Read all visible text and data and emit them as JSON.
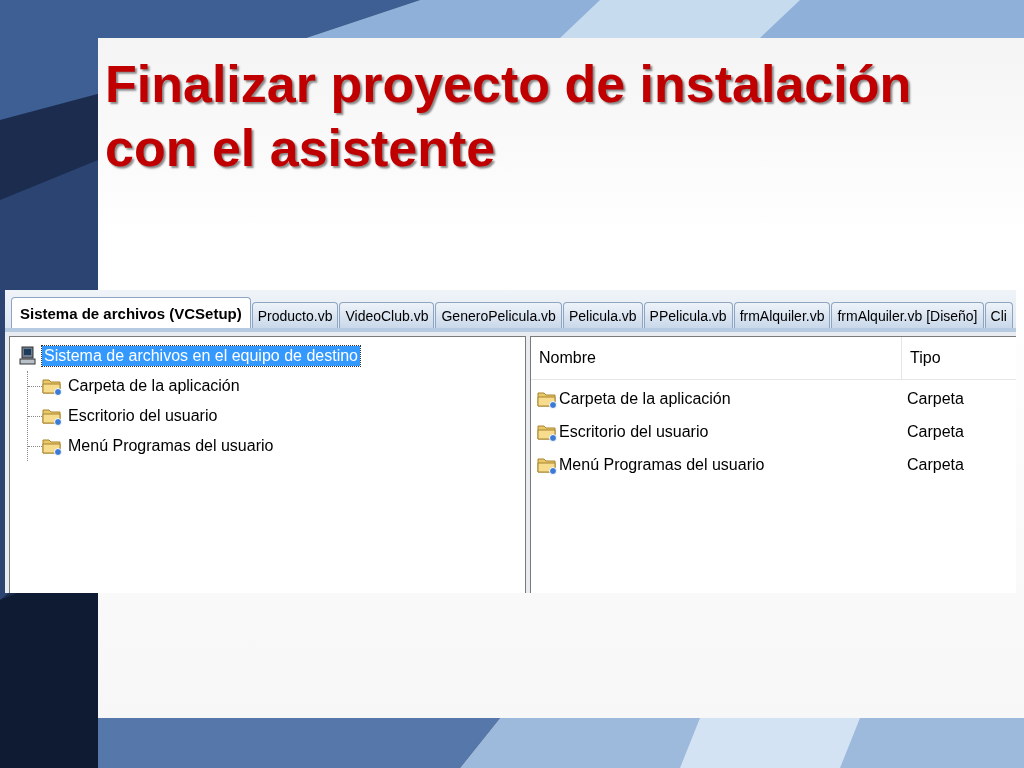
{
  "slide": {
    "title": "Finalizar proyecto de instalación con el asistente"
  },
  "tabs": [
    {
      "label": "Sistema de archivos (VCSetup)",
      "selected": true
    },
    {
      "label": "Producto.vb",
      "selected": false
    },
    {
      "label": "VideoClub.vb",
      "selected": false
    },
    {
      "label": "GeneroPelicula.vb",
      "selected": false
    },
    {
      "label": "Pelicula.vb",
      "selected": false
    },
    {
      "label": "PPelicula.vb",
      "selected": false
    },
    {
      "label": "frmAlquiler.vb",
      "selected": false
    },
    {
      "label": "frmAlquiler.vb [Diseño]",
      "selected": false
    },
    {
      "label": "Cli",
      "selected": false
    }
  ],
  "tree": {
    "items": [
      {
        "label": "Sistema de archivos en el equipo de destino",
        "kind": "computer",
        "selected": true,
        "children": [
          {
            "label": "Carpeta de la aplicación",
            "kind": "folder",
            "selected": false
          },
          {
            "label": "Escritorio del usuario",
            "kind": "folder",
            "selected": false
          },
          {
            "label": "Menú Programas del usuario",
            "kind": "folder",
            "selected": false
          }
        ]
      }
    ]
  },
  "list": {
    "columns": [
      "Nombre",
      "Tipo"
    ],
    "rows": [
      {
        "name": "Carpeta de la aplicación",
        "type": "Carpeta"
      },
      {
        "name": "Escritorio del usuario",
        "type": "Carpeta"
      },
      {
        "name": "Menú Programas del usuario",
        "type": "Carpeta"
      }
    ]
  }
}
